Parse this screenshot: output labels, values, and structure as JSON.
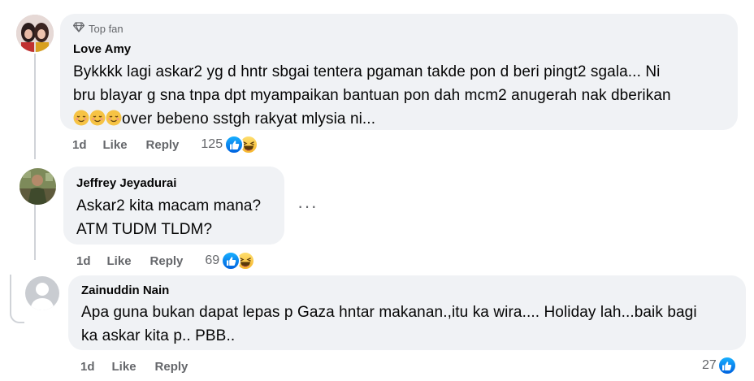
{
  "comments": [
    {
      "badge": "Top fan",
      "author": "Love Amy",
      "text_lines": [
        "Bykkkk lagi askar2 yg d hntr sbgai tentera pgaman takde pon d beri pingt2 sgala... Ni",
        "bru blayar g sna tnpa dpt myampaikan bantuan pon dah mcm2 anugerah nak dberikan"
      ],
      "text_tail": "over bebeno sstgh rakyat mlysia ni...",
      "time": "1d",
      "like_label": "Like",
      "reply_label": "Reply",
      "reaction_count": "125"
    },
    {
      "author": "Jeffrey Jeyadurai",
      "text_lines": [
        "Askar2 kita macam mana?",
        "ATM TUDM TLDM?"
      ],
      "time": "1d",
      "like_label": "Like",
      "reply_label": "Reply",
      "reaction_count": "69",
      "more_label": "···"
    },
    {
      "author": "Zainuddin Nain",
      "text_lines": [
        "Apa guna bukan dapat lepas p Gaza hntar makanan.,itu ka wira.... Holiday lah...baik bagi",
        "ka askar kita p.. PBB.."
      ],
      "time": "1d",
      "like_label": "Like",
      "reply_label": "Reply",
      "reaction_count": "27"
    }
  ],
  "icons": {
    "badge": "diamond-icon",
    "like": "thumbs-up-icon",
    "haha": "laughing-face-icon",
    "inline_emoji": "relieved-face-icon"
  },
  "colors": {
    "bubble": "#f0f2f5",
    "secondary_text": "#65676b",
    "like_blue": "#0866ff",
    "haha_yellow": "#f7b928"
  }
}
